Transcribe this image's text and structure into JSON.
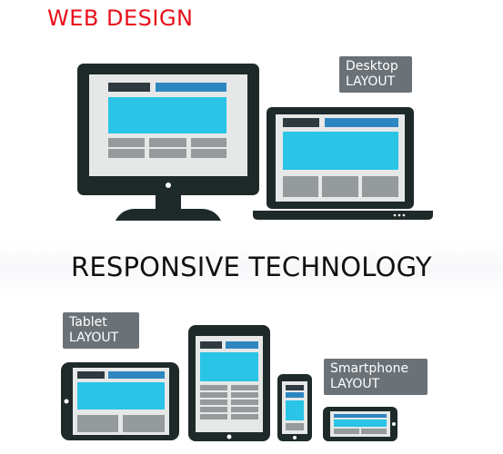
{
  "heading": "WEB DESIGN",
  "subheading": "RESPONSIVE TECHNOLOGY",
  "tags": {
    "desktop": {
      "line1": "Desktop",
      "line2": "LAYOUT"
    },
    "tablet": {
      "line1": "Tablet",
      "line2": "LAYOUT"
    },
    "smartphone": {
      "line1": "Smartphone",
      "line2": "LAYOUT"
    }
  },
  "colors": {
    "heading": "#e8101a",
    "device_body": "#1e2a2a",
    "screen_bg": "#e6e8e8",
    "content_cyan": "#29c4e6",
    "header_blue": "#2e86c1",
    "header_dark": "#2e3a40",
    "block_gray": "#959a9c",
    "tag_bg": "#6b7277"
  }
}
